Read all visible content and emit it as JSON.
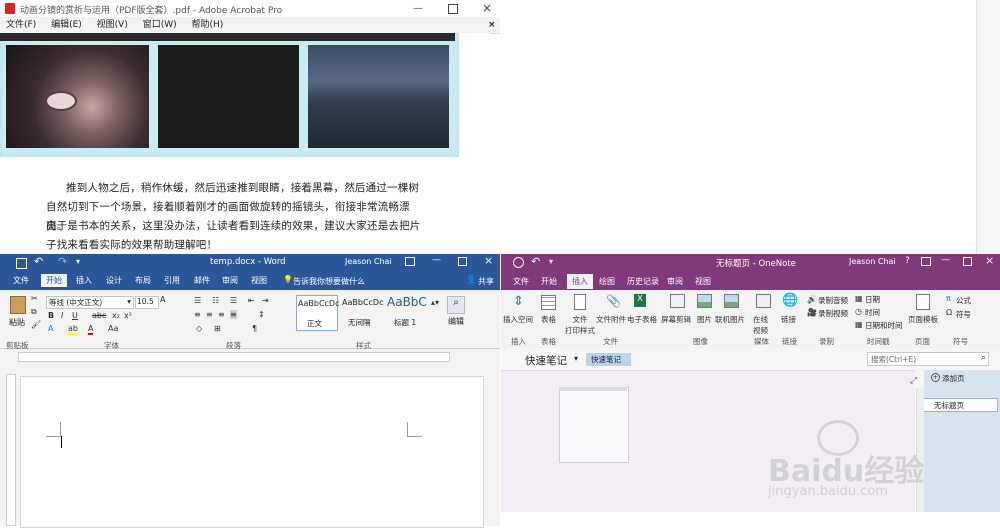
{
  "acrobat": {
    "title": "动画分镜的赏析与运用（PDF版全套）.pdf - Adobe Acrobat Pro",
    "menu": [
      "文件(F)",
      "编辑(E)",
      "视图(V)",
      "窗口(W)",
      "帮助(H)"
    ],
    "paragraph": [
      "推到人物之后，稍作休缓，然后迅速推到眼睛，接着黑幕，然后通过一棵树",
      "自然切到下一个场景，接着顺着刚才的画面做旋转的摇镜头，衔接非常流畅漂亮。",
      "由于是书本的关系，这里没办法，让读者看到连续的效果，建议大家还是去把片",
      "子找来看看实际的效果帮助理解吧！"
    ],
    "close_glyph": "×"
  },
  "word": {
    "doc_title": "temp.docx - Word",
    "user": "Jeason Chai",
    "tabs": [
      "文件",
      "开始",
      "插入",
      "设计",
      "布局",
      "引用",
      "邮件",
      "审阅",
      "视图"
    ],
    "tell_me": "告诉我你想要做什么",
    "share": "共享",
    "paste": "粘贴",
    "font_name": "等线 (中文正文)",
    "font_size": "10.5",
    "styles": [
      {
        "preview": "AaBbCcDc",
        "name": "正文"
      },
      {
        "preview": "AaBbCcDc",
        "name": "无间隔"
      },
      {
        "preview": "AaBbC",
        "name": "标题 1"
      }
    ],
    "edit": "编辑",
    "groups": [
      "剪贴板",
      "字体",
      "段落",
      "样式"
    ],
    "accent": "#2b579a"
  },
  "onenote": {
    "doc_title": "无标题页 - OneNote",
    "user": "Jeason Chai",
    "tabs": [
      "文件",
      "开始",
      "插入",
      "绘图",
      "历史记录",
      "审阅",
      "视图"
    ],
    "ribbon": {
      "insert_space": "插入空间",
      "table": "表格",
      "file_print": "文件\n打印样式",
      "attachment": "文件附件",
      "spreadsheet": "电子表格",
      "screen_clip": "屏幕剪辑",
      "picture": "图片",
      "online_picture": "联机图片",
      "online_video": "在线\n视频",
      "link": "链接",
      "record_audio": "录制音频",
      "record_video": "录制视频",
      "date": "日期",
      "time": "时间",
      "date_time": "日期和时间",
      "page_template": "页面模板",
      "equation": "公式",
      "symbol": "符号"
    },
    "groups": [
      "插入",
      "表格",
      "文件",
      "图像",
      "媒体",
      "链接",
      "录制",
      "时间戳",
      "页面",
      "符号"
    ],
    "notebook": "快速笔记",
    "section_tab": "快速笔记",
    "search_placeholder": "搜索(Ctrl+E)",
    "add_page": "添加页",
    "page_item": "无标题页",
    "accent": "#80397b"
  },
  "watermark": {
    "brand": "Baidu经验",
    "url": "jingyan.baidu.com"
  }
}
